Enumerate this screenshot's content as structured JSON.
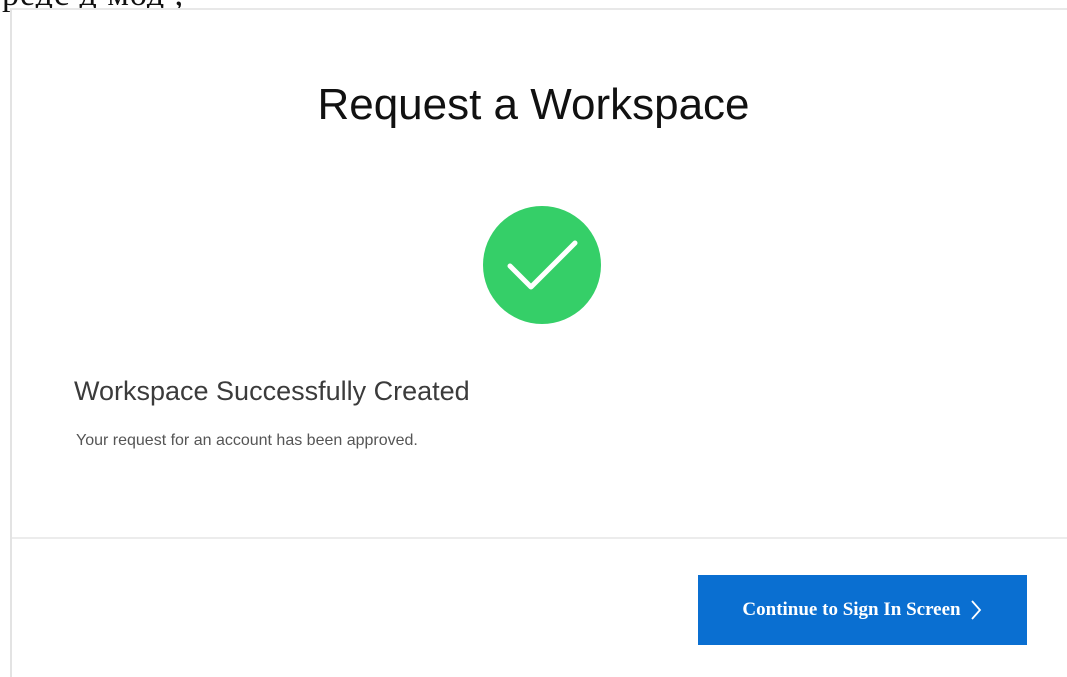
{
  "page": {
    "top_cut_text": "редс        д   мод  ,",
    "title": "Request a Workspace"
  },
  "status": {
    "icon": "check-circle-icon",
    "color": "#35cf68",
    "heading": "Workspace Successfully Created",
    "message": "Your request for an account has been approved."
  },
  "footer": {
    "continue_label": "Continue to Sign In Screen",
    "continue_icon": "chevron-right-icon",
    "button_color": "#0a6fd1"
  }
}
